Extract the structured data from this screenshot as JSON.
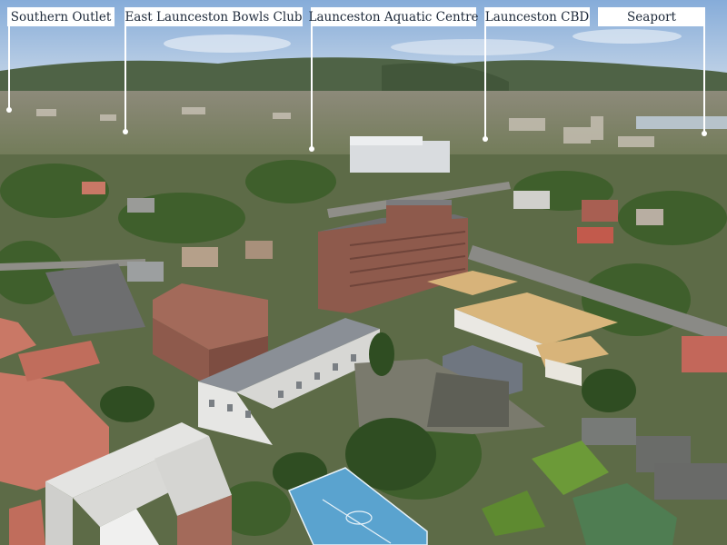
{
  "labels": [
    {
      "name": "Southern Outlet"
    },
    {
      "name": "East Launceston Bowls Club"
    },
    {
      "name": "Launceston Aquatic Centre"
    },
    {
      "name": "Launceston CBD"
    },
    {
      "name": "Seaport"
    }
  ],
  "colors": {
    "sky": "#a9c6e6",
    "hills": "#4f6346",
    "foliage": "#3f5f2c",
    "roof_terracotta": "#c97866",
    "building_brick": "#8e5a4c",
    "court_blue": "#5aa3cf",
    "label_background": "#ffffff",
    "label_text": "#1e2a3a"
  }
}
